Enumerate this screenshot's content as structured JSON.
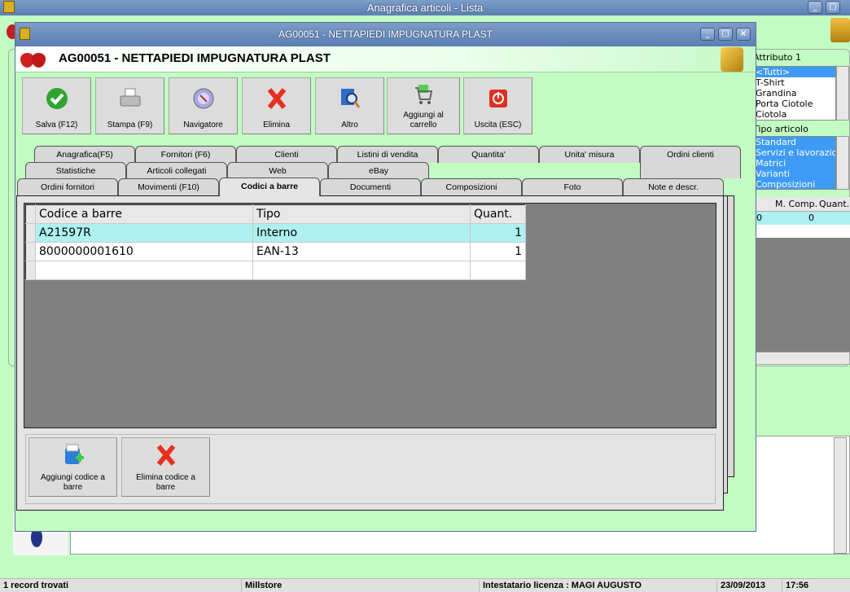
{
  "outer_window": {
    "title": "Anagrafica articoli  - Lista"
  },
  "window": {
    "title": "AG00051 - NETTAPIEDI IMPUGNATURA PLAST",
    "header": "AG00051 - NETTAPIEDI IMPUGNATURA PLAST"
  },
  "toolbar": [
    {
      "label": "Salva (F12)",
      "icon": "check-icon"
    },
    {
      "label": "Stampa (F9)",
      "icon": "printer-icon"
    },
    {
      "label": "Navigatore",
      "icon": "compass-icon"
    },
    {
      "label": "Elimina",
      "icon": "delete-x-icon"
    },
    {
      "label": "Altro",
      "icon": "magnifier-icon"
    },
    {
      "label": "Aggiungi al carrello",
      "icon": "cart-icon"
    },
    {
      "label": "Uscita (ESC)",
      "icon": "power-icon"
    }
  ],
  "tabs": {
    "row1": [
      "Anagrafica(F5)",
      "Fornitori (F6)",
      "Clienti",
      "Listini di vendita",
      "Quantita'",
      "Unita' misura",
      "Ordini clienti"
    ],
    "row2": [
      "Statistiche",
      "Articoli collegati",
      "Web",
      "eBay"
    ],
    "row3": [
      "Ordini fornitori",
      "Movimenti (F10)",
      "Codici a barre",
      "Documenti",
      "Composizioni",
      "Foto",
      "Note e descr."
    ],
    "active": "Codici a barre"
  },
  "barcode_table": {
    "columns": [
      "Codice a barre",
      "Tipo",
      "Quant."
    ],
    "rows": [
      {
        "code": "A21597R",
        "type": "Interno",
        "qty": "1"
      },
      {
        "code": "8000000001610",
        "type": "EAN-13",
        "qty": "1"
      }
    ]
  },
  "bottom_buttons": [
    {
      "label": "Aggiungi codice a barre"
    },
    {
      "label": "Elimina codice a barre"
    }
  ],
  "right_panel": {
    "attributo_label": "Attributo 1",
    "attributo_items": [
      "<Tutti>",
      "T-Shirt",
      "Grandina",
      "Porta Ciotole",
      "Ciotola"
    ],
    "tipo_label": "Tipo articolo",
    "tipo_items": [
      "Standard",
      "Servizi e lavorazioni",
      "Matrici",
      "Varianti",
      "Composizioni"
    ],
    "grid_columns": [
      "M. Comp.",
      "Quant.."
    ],
    "grid_row": {
      "m_comp": "0",
      "first": "0"
    }
  },
  "status": {
    "records": "1 record trovati",
    "company": "Millstore",
    "license": "Intestatario licenza : MAGI AUGUSTO",
    "date": "23/09/2013",
    "time": "17:56"
  },
  "colors": {
    "selected_row": "#aef0f0",
    "list_selection": "#3d9bf5",
    "background": "#c2fcc2"
  }
}
